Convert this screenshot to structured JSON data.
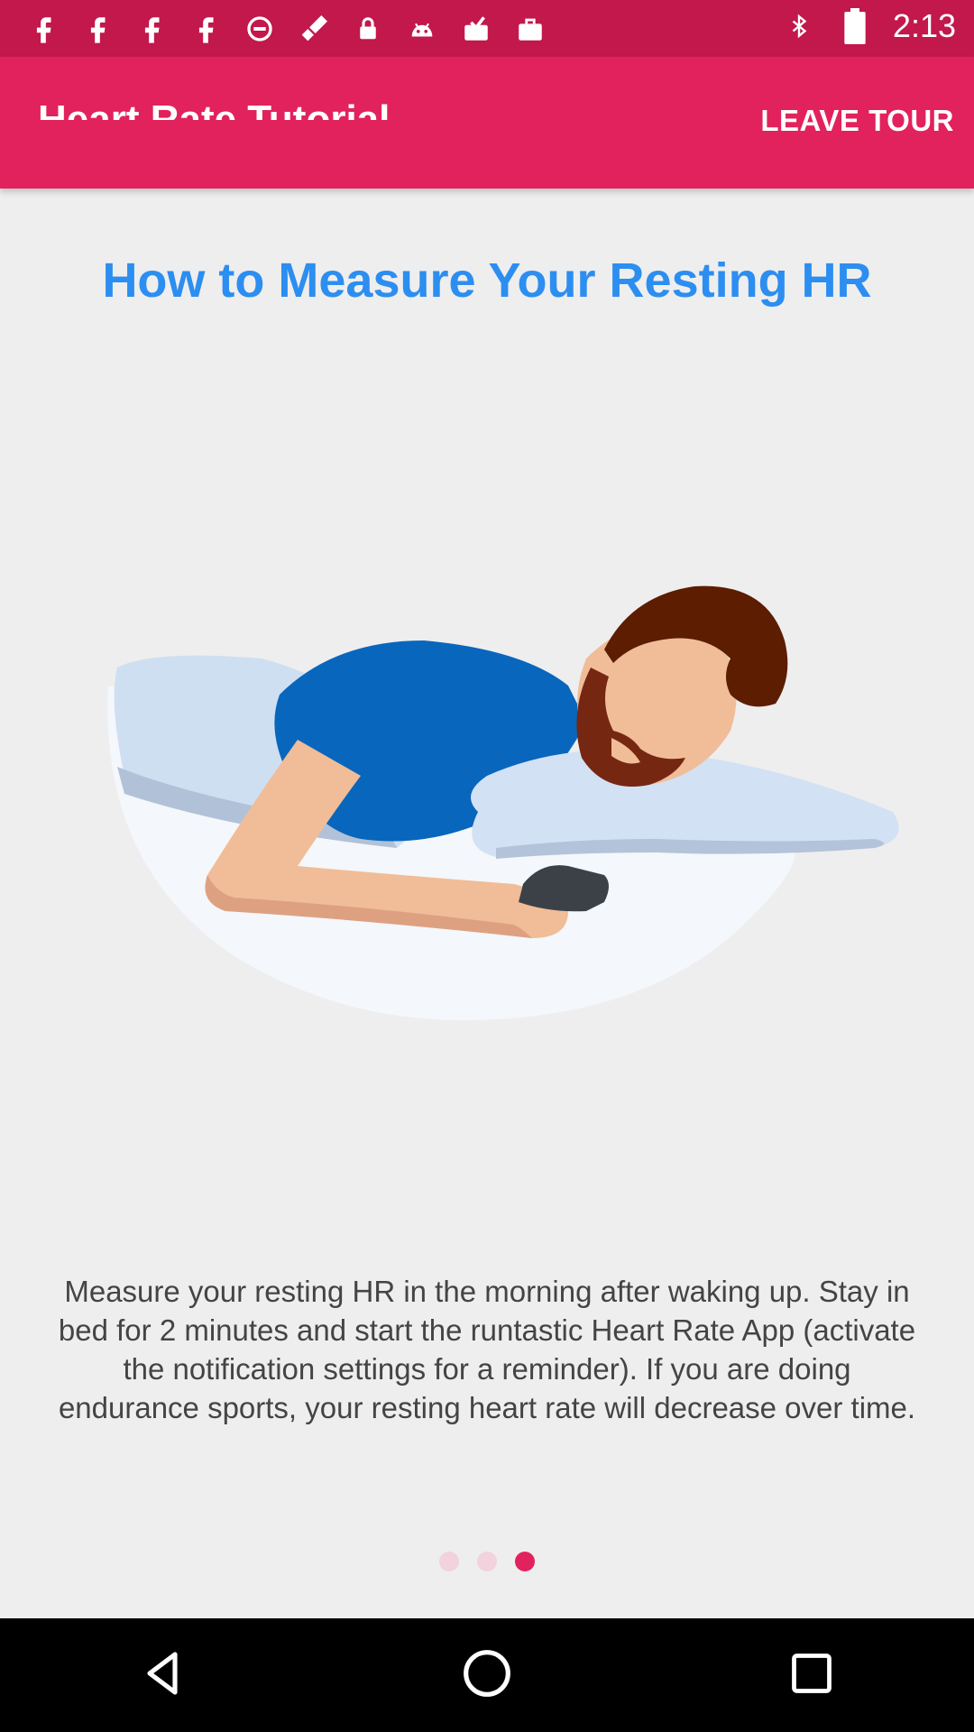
{
  "status_bar": {
    "time": "2:13",
    "left_icons": [
      "facebook-icon",
      "facebook-icon",
      "facebook-icon",
      "facebook-icon",
      "blocked-icon",
      "fake-gps-icon",
      "lock-icon",
      "android-icon",
      "task-icon",
      "briefcase-icon"
    ],
    "right_icons": [
      "bluetooth-icon",
      "battery-icon"
    ]
  },
  "app_bar": {
    "title": "Heart Rate Tutorial",
    "action": "LEAVE TOUR"
  },
  "main": {
    "headline": "How to Measure Your Resting HR",
    "description": "Measure your resting HR in the morning after waking up. Stay in bed for 2 minutes and start the runtastic Heart Rate App (activate the notification settings for a reminder). If you are doing endurance sports, your resting heart rate will decrease over time.",
    "pager": {
      "total": 3,
      "active": 3
    }
  },
  "colors": {
    "status_bar": "#c2184c",
    "app_bar": "#e2225c",
    "headline": "#2c8ef0",
    "background": "#eeeeee",
    "dot_active": "#e2225c",
    "dot_inactive": "#f2d2dc"
  },
  "nav_bar": {
    "buttons": [
      "back-icon",
      "home-icon",
      "recents-icon"
    ]
  }
}
